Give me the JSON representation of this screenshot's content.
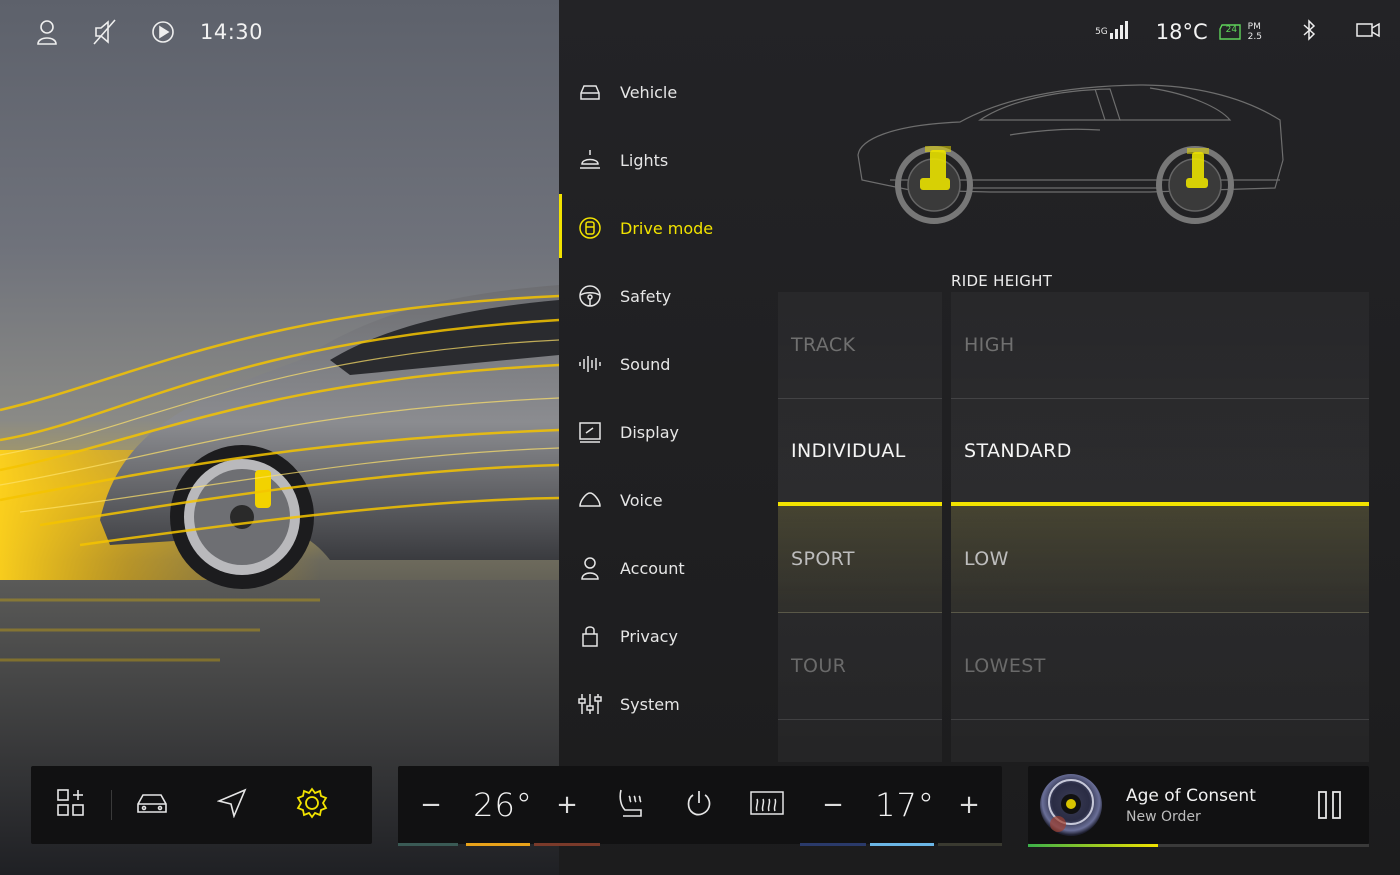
{
  "status": {
    "time": "14:30",
    "network": "5G",
    "temperature": "18°C",
    "battery_badge": "24",
    "pm_label": "PM",
    "pm_value": "2.5"
  },
  "menu": {
    "items": [
      {
        "label": "Vehicle",
        "icon": "car-icon"
      },
      {
        "label": "Lights",
        "icon": "lamp-icon"
      },
      {
        "label": "Drive mode",
        "icon": "drive-mode-icon",
        "active": true
      },
      {
        "label": "Safety",
        "icon": "steering-wheel-icon"
      },
      {
        "label": "Sound",
        "icon": "sound-wave-icon"
      },
      {
        "label": "Display",
        "icon": "display-icon"
      },
      {
        "label": "Voice",
        "icon": "cloud-icon"
      },
      {
        "label": "Account",
        "icon": "person-icon"
      },
      {
        "label": "Privacy",
        "icon": "lock-icon"
      },
      {
        "label": "System",
        "icon": "sliders-icon"
      }
    ]
  },
  "drive": {
    "ride_height_title": "RIDE HEIGHT",
    "modes": [
      "TRACK",
      "INDIVIDUAL",
      "SPORT",
      "TOUR"
    ],
    "heights": [
      "HIGH",
      "STANDARD",
      "LOW",
      "LOWEST"
    ],
    "selected_mode": "INDIVIDUAL",
    "selected_height": "STANDARD"
  },
  "climate": {
    "left_temp": "26°",
    "right_temp": "17°",
    "minus": "−",
    "plus": "+"
  },
  "media": {
    "song": "Age of Consent",
    "artist": "New Order",
    "progress": 0.38
  },
  "colors": {
    "accent": "#f2e300",
    "progress_start": "#3bb04a"
  }
}
